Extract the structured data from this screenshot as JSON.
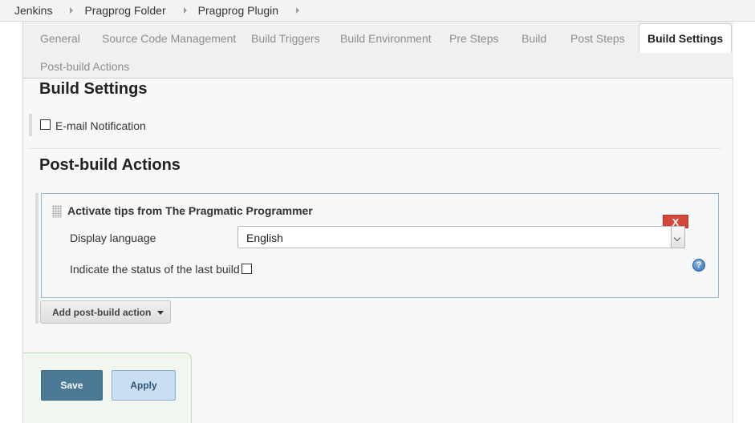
{
  "breadcrumb": {
    "items": [
      "Jenkins",
      "Pragprog Folder",
      "Pragprog Plugin"
    ]
  },
  "tabs": [
    {
      "label": "General"
    },
    {
      "label": "Source Code Management"
    },
    {
      "label": "Build Triggers"
    },
    {
      "label": "Build Environment"
    },
    {
      "label": "Pre Steps"
    },
    {
      "label": "Build"
    },
    {
      "label": "Post Steps"
    },
    {
      "label": "Build Settings",
      "active": true
    },
    {
      "label": "Post-build Actions"
    }
  ],
  "build_settings": {
    "title": "Build Settings",
    "email_notification_label": "E-mail Notification",
    "email_notification_checked": false
  },
  "post_build": {
    "title": "Post-build Actions",
    "step": {
      "title": "Activate tips from The Pragmatic Programmer",
      "delete_label": "X",
      "language_label": "Display language",
      "language_value": "English",
      "status_label": "Indicate the status of the last build",
      "status_checked": false,
      "help_glyph": "?"
    },
    "add_action_label": "Add post-build action"
  },
  "buttons": {
    "save": "Save",
    "apply": "Apply"
  },
  "colors": {
    "delete": "#d24939",
    "save": "#4a7a96",
    "apply": "#c9def2",
    "step_border": "#93b6d9"
  },
  "icons": [
    "chevron-right-icon",
    "drag-handle-icon",
    "chevron-down-icon",
    "help-icon",
    "caret-down-icon"
  ]
}
